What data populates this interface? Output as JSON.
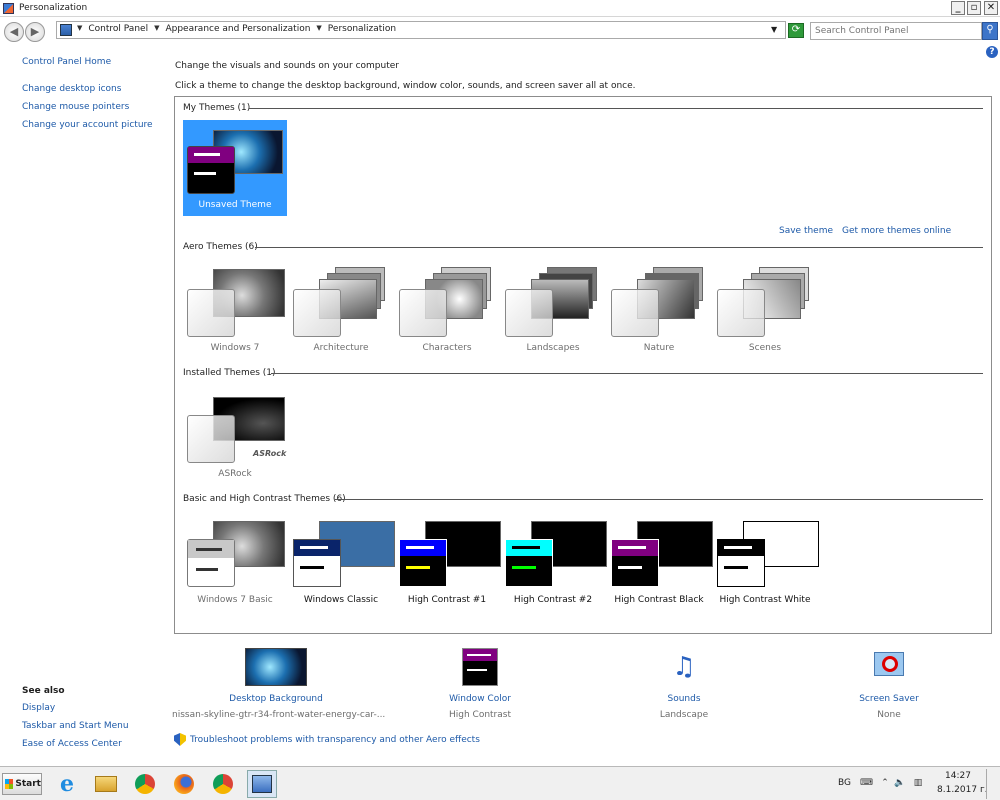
{
  "window": {
    "title": "Personalization"
  },
  "address": {
    "crumbs": [
      "Control Panel",
      "Appearance and Personalization",
      "Personalization"
    ],
    "search_placeholder": "Search Control Panel"
  },
  "sidebar": {
    "home": "Control Panel Home",
    "links": [
      "Change desktop icons",
      "Change mouse pointers",
      "Change your account picture"
    ],
    "see_also_title": "See also",
    "see_also": [
      "Display",
      "Taskbar and Start Menu",
      "Ease of Access Center"
    ]
  },
  "main": {
    "heading": "Change the visuals and sounds on your computer",
    "subheading": "Click a theme to change the desktop background, window color, sounds, and screen saver all at once.",
    "save_theme": "Save theme",
    "get_more": "Get more themes online",
    "groups": {
      "my": {
        "title": "My Themes (1)",
        "themes": [
          "Unsaved Theme"
        ]
      },
      "aero": {
        "title": "Aero Themes (6)",
        "themes": [
          "Windows 7",
          "Architecture",
          "Characters",
          "Landscapes",
          "Nature",
          "Scenes"
        ]
      },
      "installed": {
        "title": "Installed Themes (1)",
        "themes": [
          "ASRock"
        ],
        "brand_text": "ASRock"
      },
      "basic": {
        "title": "Basic and High Contrast Themes (6)",
        "themes": [
          "Windows 7 Basic",
          "Windows Classic",
          "High Contrast #1",
          "High Contrast #2",
          "High Contrast Black",
          "High Contrast White"
        ]
      }
    }
  },
  "quick_settings": [
    {
      "label": "Desktop Background",
      "value": "nissan-skyline-gtr-r34-front-water-energy-car-...",
      "icon": "wallpaper-icon"
    },
    {
      "label": "Window Color",
      "value": "High Contrast",
      "icon": "window-color-icon"
    },
    {
      "label": "Sounds",
      "value": "Landscape",
      "icon": "music-notes-icon"
    },
    {
      "label": "Screen Saver",
      "value": "None",
      "icon": "screen-saver-icon"
    }
  ],
  "troubleshoot": "Troubleshoot problems with transparency and other Aero effects",
  "taskbar": {
    "start": "Start",
    "language": "BG",
    "time": "14:27",
    "date": "8.1.2017 г."
  },
  "colors": {
    "link": "#1e5aa8",
    "selection": "#3399ff",
    "hc1_bar": "#0000ff",
    "hc2_bar": "#00ffff",
    "hc_black_bar": "#800080",
    "classic_bar": "#0a246a"
  }
}
